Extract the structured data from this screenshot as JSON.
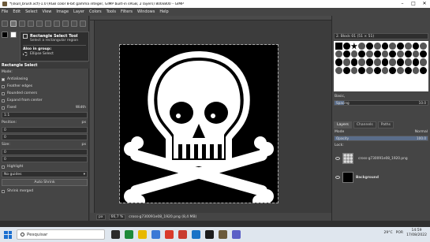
{
  "window": {
    "title": "*[skull_brush.xcf]-1.0 (RGB color 8-bit gamma integer, GIMP built-in sRGB, 2 layers) 800x800 – GIMP",
    "minimize": "–",
    "maximize": "□",
    "close": "✕"
  },
  "menu": [
    "File",
    "Edit",
    "Select",
    "View",
    "Image",
    "Layer",
    "Colors",
    "Tools",
    "Filters",
    "Windows",
    "Help"
  ],
  "tooltip": {
    "title": "Rectangle Select Tool",
    "description": "Select a rectangular region",
    "also_label": "Also in group:",
    "also_item": "Ellipse Select"
  },
  "tool_options": {
    "header": "Rectangle Select",
    "mode_label": "Mode:",
    "antialiasing": "Antialiasing",
    "feather_edges": "Feather edges",
    "rounded_corners": "Rounded corners",
    "expand_from_center": "Expand from center",
    "fixed_label": "Fixed",
    "fixed_value": "Width",
    "fixed_amount": "1:1",
    "position_label": "Position:",
    "position_unit": "px",
    "position_x": "0",
    "position_y": "0",
    "size_label": "Size:",
    "size_unit": "px",
    "size_w": "0",
    "size_h": "0",
    "highlight": "Highlight",
    "guides_value": "No guides",
    "auto_shrink": "Auto Shrink",
    "shrink_merged": "Shrink merged"
  },
  "status": {
    "unit": "px",
    "zoom": "66,7 %",
    "info": "cross-g730091e08_1920.png (8,4 MB)"
  },
  "right_panel": {
    "brush_name": "2. Block 01 (51 × 51)",
    "basic_label": "Basic,",
    "spacing_label": "Spacing",
    "spacing_value": "10.0",
    "spacing_percent": 10,
    "tabs": [
      "Layers",
      "Channels",
      "Paths"
    ],
    "mode_label": "Mode",
    "mode_value": "Normal",
    "opacity_label": "Opacity",
    "opacity_value": "100.0",
    "lock_label": "Lock:",
    "layers": [
      {
        "name": "cross-g730091e08_1920.png",
        "bold": false
      },
      {
        "name": "Background",
        "bold": true
      }
    ]
  },
  "taskbar": {
    "search_placeholder": "Pesquisar",
    "weather": "29°C",
    "language": "POR",
    "time": "14:59",
    "date": "17/08/2022"
  }
}
